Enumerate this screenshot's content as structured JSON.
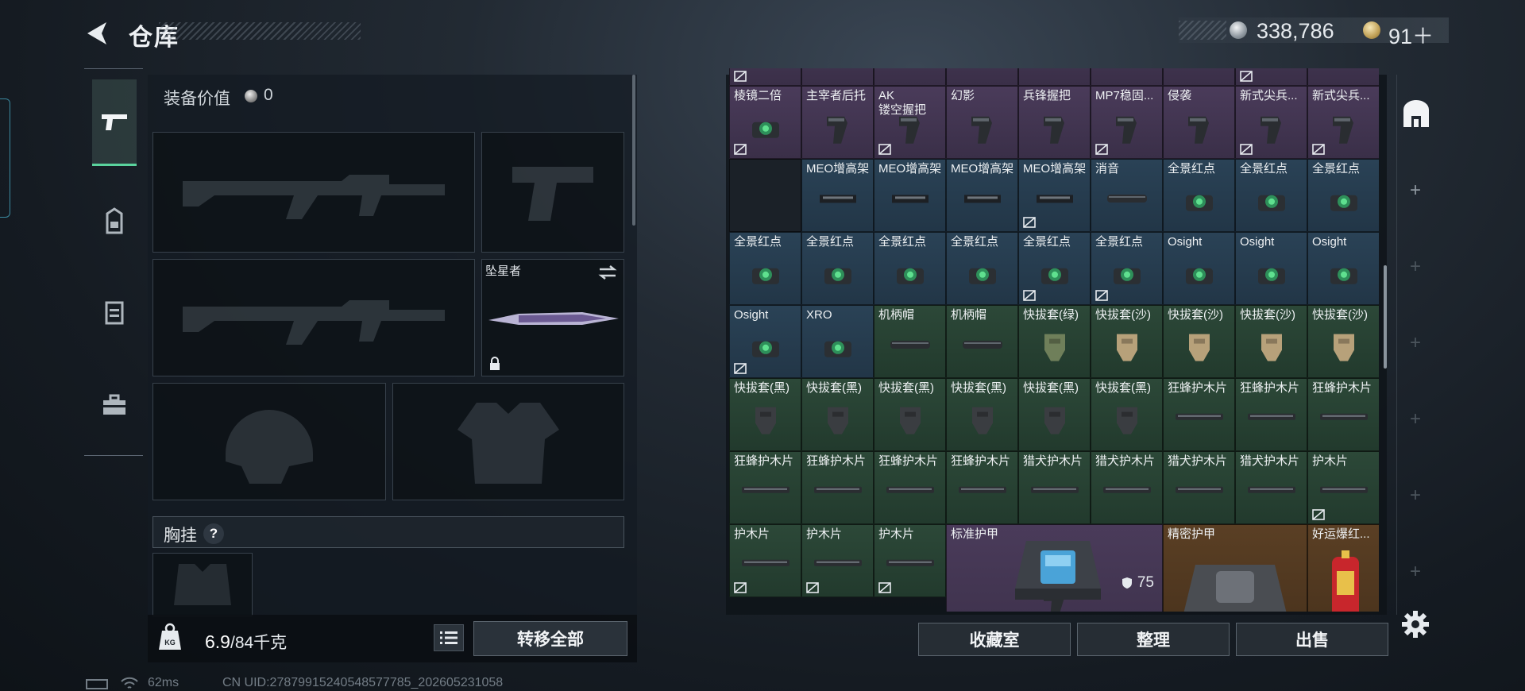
{
  "header": {
    "title": "仓库",
    "currency_primary": "338,786",
    "currency_secondary": "91＋"
  },
  "loadout": {
    "value_label": "装备价值",
    "value_amount": "0",
    "slots": {
      "primary_weapon": "",
      "pistol": "",
      "secondary_weapon": "",
      "melee_name": "坠星者",
      "helmet": "",
      "armor": ""
    },
    "chest_rig_label": "胸挂",
    "chest_rig_help": "?",
    "weight_value": "6.9",
    "weight_capacity": "/84千克",
    "transfer_all": "转移全部"
  },
  "inventory": {
    "rows": [
      {
        "color": "purple",
        "items": [
          {
            "name": "",
            "lock": true
          },
          {
            "name": "",
            "lock": false
          },
          {
            "name": "",
            "lock": false
          },
          {
            "name": "",
            "lock": false
          },
          {
            "name": "",
            "lock": false
          },
          {
            "name": "",
            "lock": false
          },
          {
            "name": "",
            "lock": false
          },
          {
            "name": "",
            "lock": true
          },
          {
            "name": "",
            "lock": false
          }
        ]
      },
      {
        "color": "purple",
        "items": [
          {
            "name": "棱镜二倍",
            "lock": true
          },
          {
            "name": "主宰者后托",
            "lock": false
          },
          {
            "name": "AK\n镂空握把",
            "lock": true
          },
          {
            "name": "幻影",
            "lock": false
          },
          {
            "name": "兵锋握把",
            "lock": false
          },
          {
            "name": "MP7稳固...",
            "lock": true
          },
          {
            "name": "侵袭",
            "lock": false
          },
          {
            "name": "新式尖兵...",
            "lock": true
          },
          {
            "name": "新式尖兵...",
            "lock": true
          }
        ]
      },
      {
        "color": "blue",
        "items": [
          {
            "name": "",
            "lock": false,
            "color": "dark"
          },
          {
            "name": "MEO增高架",
            "lock": false
          },
          {
            "name": "MEO增高架",
            "lock": false
          },
          {
            "name": "MEO增高架",
            "lock": false
          },
          {
            "name": "MEO增高架",
            "lock": true
          },
          {
            "name": "消音",
            "lock": false
          },
          {
            "name": "全景红点",
            "lock": false
          },
          {
            "name": "全景红点",
            "lock": false
          },
          {
            "name": "全景红点",
            "lock": false
          }
        ]
      },
      {
        "color": "blue",
        "items": [
          {
            "name": "全景红点",
            "lock": false
          },
          {
            "name": "全景红点",
            "lock": false
          },
          {
            "name": "全景红点",
            "lock": false
          },
          {
            "name": "全景红点",
            "lock": false
          },
          {
            "name": "全景红点",
            "lock": true
          },
          {
            "name": "全景红点",
            "lock": true
          },
          {
            "name": "Osight",
            "lock": false
          },
          {
            "name": "Osight",
            "lock": false
          },
          {
            "name": "Osight",
            "lock": false
          }
        ]
      },
      {
        "color": "mixed",
        "items": [
          {
            "name": "Osight",
            "lock": true,
            "color": "blue"
          },
          {
            "name": "XRO",
            "lock": false,
            "color": "blue"
          },
          {
            "name": "机柄帽",
            "lock": false,
            "color": "green"
          },
          {
            "name": "机柄帽",
            "lock": false,
            "color": "green"
          },
          {
            "name": "快拔套(绿)",
            "lock": false,
            "color": "green"
          },
          {
            "name": "快拔套(沙)",
            "lock": false,
            "color": "green"
          },
          {
            "name": "快拔套(沙)",
            "lock": false,
            "color": "green"
          },
          {
            "name": "快拔套(沙)",
            "lock": false,
            "color": "green"
          },
          {
            "name": "快拔套(沙)",
            "lock": false,
            "color": "green"
          }
        ]
      },
      {
        "color": "green",
        "items": [
          {
            "name": "快拔套(黑)",
            "lock": false
          },
          {
            "name": "快拔套(黑)",
            "lock": false
          },
          {
            "name": "快拔套(黑)",
            "lock": false
          },
          {
            "name": "快拔套(黑)",
            "lock": false
          },
          {
            "name": "快拔套(黑)",
            "lock": false
          },
          {
            "name": "快拔套(黑)",
            "lock": false
          },
          {
            "name": "狂蜂护木片",
            "lock": false
          },
          {
            "name": "狂蜂护木片",
            "lock": false
          },
          {
            "name": "狂蜂护木片",
            "lock": false
          }
        ]
      },
      {
        "color": "green",
        "items": [
          {
            "name": "狂蜂护木片",
            "lock": false
          },
          {
            "name": "狂蜂护木片",
            "lock": false
          },
          {
            "name": "狂蜂护木片",
            "lock": false
          },
          {
            "name": "狂蜂护木片",
            "lock": false
          },
          {
            "name": "猎犬护木片",
            "lock": false
          },
          {
            "name": "猎犬护木片",
            "lock": false
          },
          {
            "name": "猎犬护木片",
            "lock": false
          },
          {
            "name": "猎犬护木片",
            "lock": false
          },
          {
            "name": "护木片",
            "lock": true
          }
        ]
      }
    ],
    "last_row_small": [
      {
        "name": "护木片",
        "lock": true
      },
      {
        "name": "护木片",
        "lock": true
      },
      {
        "name": "护木片",
        "lock": true
      }
    ],
    "armor_standard": {
      "name": "标准护甲",
      "durability": "75"
    },
    "armor_precision": {
      "name": "精密护甲"
    },
    "lucky_item": {
      "name": "好运爆红..."
    }
  },
  "actions": {
    "collection_room": "收藏室",
    "organize": "整理",
    "sell": "出售"
  },
  "status_bar": {
    "ping": "62ms",
    "uid": "CN UID:27879915240548577785_202605231058"
  },
  "colors": {
    "accent_green": "#5ad39d",
    "rarity_purple": "#4a3b5a",
    "rarity_blue": "#2a4256",
    "rarity_green": "#2c4838",
    "rarity_gold": "#5a3f24"
  },
  "icons": [
    "back-arrow-icon",
    "silver-coin-icon",
    "gold-coin-icon",
    "pistol-icon",
    "backpack-icon",
    "vest-icon",
    "toolbox-icon",
    "lock-icon",
    "swap-icon",
    "weight-icon",
    "list-icon",
    "shield-icon",
    "plus-icon",
    "gear-icon",
    "battery-icon",
    "wifi-icon"
  ]
}
